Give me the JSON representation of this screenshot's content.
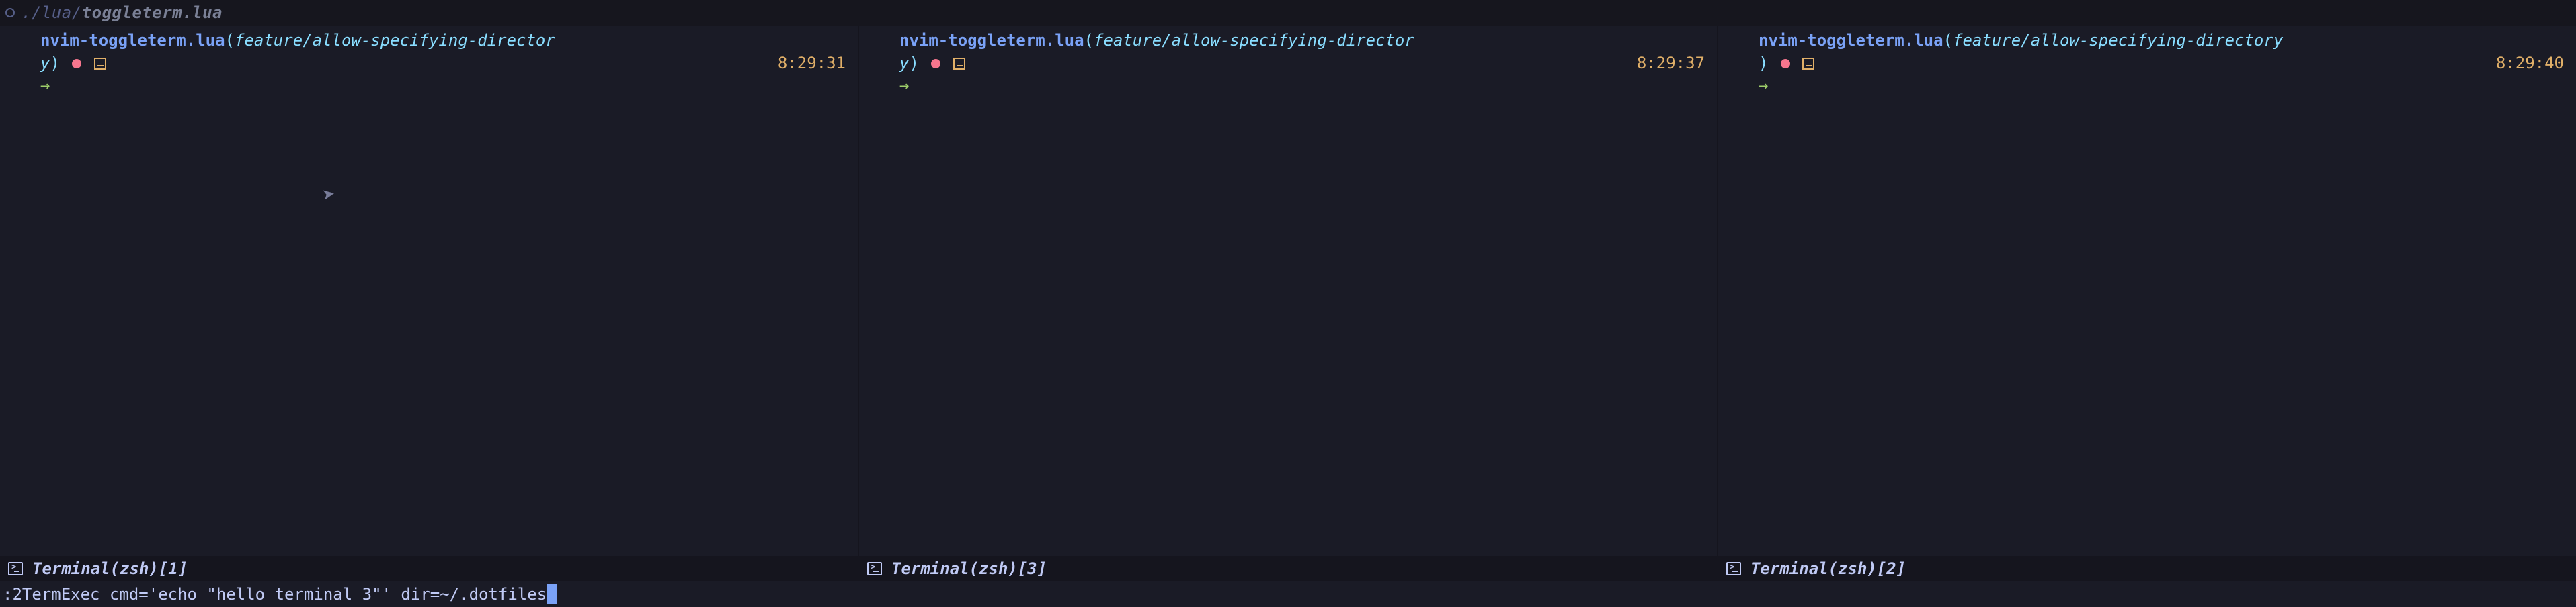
{
  "tabline": {
    "prefix": "./lua/",
    "file": "toggleterm.lua"
  },
  "panes": [
    {
      "dir": "nvim-toggleterm.lua",
      "branch_head": "feature/allow-specifying-director",
      "branch_tail": "y",
      "time": "8:29:31",
      "winbar": "Terminal(zsh)[1]",
      "show_cursor": true
    },
    {
      "dir": "nvim-toggleterm.lua",
      "branch_head": "feature/allow-specifying-director",
      "branch_tail": "y",
      "time": "8:29:37",
      "winbar": "Terminal(zsh)[3]",
      "show_cursor": false
    },
    {
      "dir": "nvim-toggleterm.lua",
      "branch_head": "feature/allow-specifying-directory",
      "branch_tail": "",
      "time": "8:29:40",
      "winbar": "Terminal(zsh)[2]",
      "show_cursor": false
    }
  ],
  "cmdline": ":2TermExec cmd='echo \"hello terminal 3\"' dir=~/.dotfiles"
}
